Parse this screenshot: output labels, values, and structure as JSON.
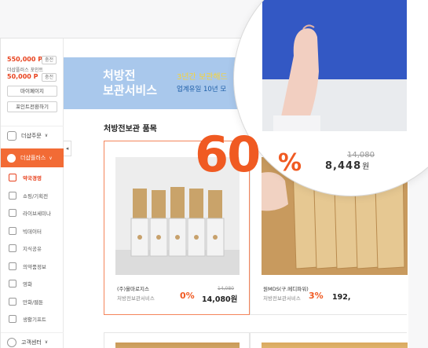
{
  "sidebar": {
    "points1": "550,000 P",
    "tag1": "충전",
    "points2_label": "더샵플러스 포인트",
    "points2": "50,000 P",
    "tag2": "충전",
    "btn1": "마이페이지",
    "btn2": "포인트전환하기",
    "nav1": "더샵주문",
    "nav1_chev": "∨",
    "nav2": "더샵플러스",
    "nav2_chev": "∨",
    "items": [
      {
        "label": "약국경영",
        "icon": "pharmacy-icon",
        "active": true
      },
      {
        "label": "쇼핑/기획전",
        "icon": "shopping-icon"
      },
      {
        "label": "라이브세미나",
        "icon": "live-icon"
      },
      {
        "label": "빅데이터",
        "icon": "chart-icon"
      },
      {
        "label": "지식공유",
        "icon": "pencil-icon"
      },
      {
        "label": "의약품정보",
        "icon": "drug-info-icon"
      },
      {
        "label": "영화",
        "icon": "movie-icon"
      },
      {
        "label": "만화/웹툰",
        "icon": "comic-icon"
      },
      {
        "label": "생활기프트",
        "icon": "gift-icon"
      }
    ],
    "nav3": "고객센터",
    "nav3_chev": "∨",
    "collapse": "◂"
  },
  "banner": {
    "title_line1": "처방전",
    "title_line2": "보관서비스",
    "headline": "3년간 보관해드",
    "subline": "업계유일 10년 모"
  },
  "section_title": "처방전보관 품목",
  "products": [
    {
      "name": "(주)올마로지스",
      "category": "처방전보관서비스",
      "discount": "0%",
      "old_price": "14,080",
      "price": "14,080원"
    },
    {
      "name": "원MDS(구.메디파워)",
      "category": "처방전보관서비스",
      "discount": "3%",
      "price": "192,"
    }
  ],
  "zoom": {
    "discount": "60",
    "percent": "%",
    "old_price": "14,080",
    "price": "8,448",
    "currency": "원"
  },
  "colors": {
    "accent": "#f05a22",
    "banner": "#a9c8ec",
    "highlight": "#f6d33b"
  }
}
